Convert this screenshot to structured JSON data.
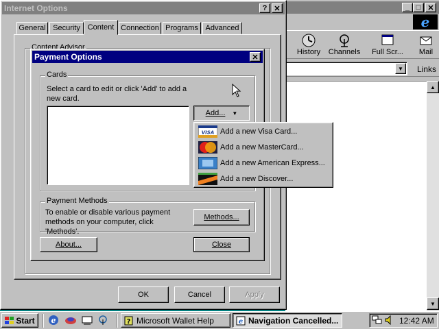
{
  "ie_window": {
    "toolbar": [
      {
        "label": "History",
        "icon": "history-icon"
      },
      {
        "label": "Channels",
        "icon": "channels-icon"
      },
      {
        "label": "Full Scr...",
        "icon": "fullscreen-icon"
      },
      {
        "label": "Mail",
        "icon": "mail-icon"
      }
    ],
    "links_label": "Links"
  },
  "internet_options": {
    "title": "Internet Options",
    "tabs": [
      "General",
      "Security",
      "Content",
      "Connection",
      "Programs",
      "Advanced"
    ],
    "active_tab": "Content",
    "content_advisor_label": "Content Advisor",
    "ok_label": "OK",
    "cancel_label": "Cancel",
    "apply_label": "Apply"
  },
  "payment_options": {
    "title": "Payment Options",
    "cards_group_label": "Cards",
    "cards_instruction": "Select a card to edit or click 'Add' to add a new card.",
    "add_label": "Add...",
    "payment_methods_group_label": "Payment Methods",
    "payment_methods_text": "To enable or disable various payment methods on your computer, click 'Methods'.",
    "methods_label": "Methods...",
    "about_label": "About...",
    "close_label": "Close"
  },
  "add_menu": {
    "items": [
      {
        "label": "Add a new Visa Card...",
        "icon": "visa-card-icon"
      },
      {
        "label": "Add a new MasterCard...",
        "icon": "mastercard-icon"
      },
      {
        "label": "Add a new American Express...",
        "icon": "amex-card-icon"
      },
      {
        "label": "Add a new Discover...",
        "icon": "discover-card-icon"
      }
    ]
  },
  "taskbar": {
    "start_label": "Start",
    "tasks": [
      {
        "label": "Microsoft Wallet Help"
      },
      {
        "label": "Navigation Cancelled..."
      }
    ],
    "clock": "12:42 AM"
  },
  "colors": {
    "desktop": "#008080",
    "active_title": "#000080",
    "inactive_title": "#808080",
    "face": "#c0c0c0"
  }
}
